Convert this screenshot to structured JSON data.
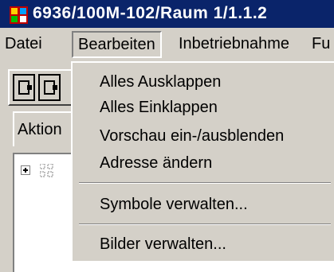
{
  "window": {
    "title": "6936/100M-102/Raum 1/1.1.2",
    "icon": "window-app-icon"
  },
  "menubar": {
    "items": [
      {
        "label": "Datei"
      },
      {
        "label": "Bearbeiten",
        "active": true
      },
      {
        "label": "Inbetriebnahme"
      },
      {
        "label": "Fu"
      }
    ]
  },
  "toolbar": {
    "buttons": [
      {
        "icon": "save-icon"
      },
      {
        "icon": "save-icon"
      }
    ]
  },
  "panel": {
    "tab_label": "Aktion",
    "tree": {
      "expander": "plus-icon",
      "node_icon": "tree-node-icon"
    }
  },
  "dropdown": {
    "items": [
      {
        "label": "Alles Ausklappen"
      },
      {
        "label": "Alles Einklappen"
      },
      {
        "label": "Vorschau ein-/ausblenden"
      },
      {
        "label": "Adresse ändern"
      },
      {
        "separator": true
      },
      {
        "label": "Symbole verwalten..."
      },
      {
        "separator": true
      },
      {
        "label": "Bilder verwalten..."
      }
    ]
  },
  "colors": {
    "titlebar": "#0a246a",
    "chrome": "#d4d0c8",
    "title_text": "#ffffff"
  }
}
